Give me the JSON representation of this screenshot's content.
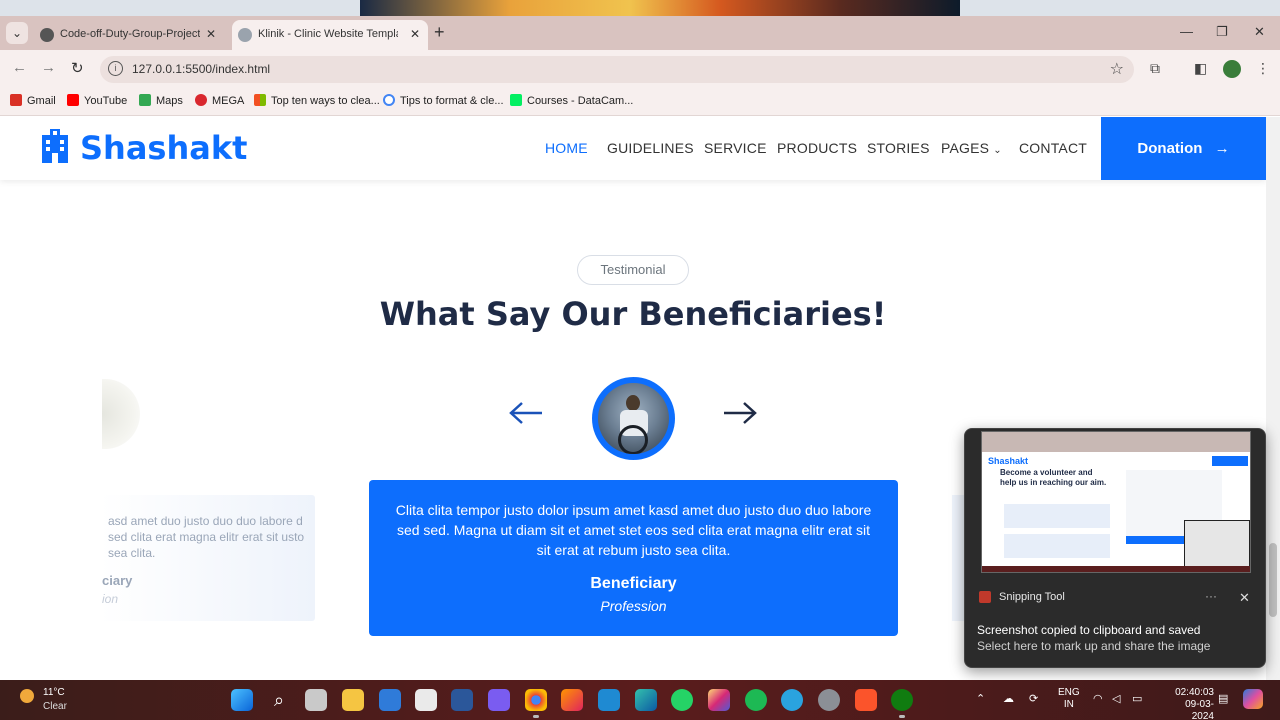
{
  "browser": {
    "tabs": [
      {
        "label": "Code-off-Duty-Group-Project/F",
        "active": false
      },
      {
        "label": "Klinik - Clinic Website Template",
        "active": true
      }
    ],
    "url": "127.0.0.1:5500/index.html",
    "bookmarks": [
      {
        "label": "Gmail",
        "icon": "gmail-icon",
        "color": "#d93025"
      },
      {
        "label": "YouTube",
        "icon": "youtube-icon",
        "color": "#ff0000"
      },
      {
        "label": "Maps",
        "icon": "maps-icon",
        "color": "#34a853"
      },
      {
        "label": "MEGA",
        "icon": "mega-icon",
        "color": "#d9272e"
      },
      {
        "label": "Top ten ways to clea...",
        "icon": "windows-icon",
        "color": "#f25022"
      },
      {
        "label": "Tips to format & cle...",
        "icon": "google-icon",
        "color": "#4285f4"
      },
      {
        "label": "Courses - DataCam...",
        "icon": "datacamp-icon",
        "color": "#03ef62"
      }
    ]
  },
  "site": {
    "brand": "Shashakt",
    "menu": [
      "HOME",
      "GUIDELINES",
      "SERVICE",
      "PRODUCTS",
      "STORIES",
      "PAGES",
      "CONTACT"
    ],
    "active_menu": "HOME",
    "donate_label": "Donation",
    "accent": "#0d6efd"
  },
  "testimonial": {
    "pill": "Testimonial",
    "heading": "What Say Our Beneficiaries!",
    "active": {
      "text": "Clita clita tempor justo dolor ipsum amet kasd amet duo justo duo duo labore sed sed. Magna ut diam sit et amet stet eos sed clita erat magna elitr erat sit sit erat at rebum justo sea clita.",
      "name": "Beneficiary",
      "profession": "Profession"
    },
    "side_left": {
      "text": "asd amet duo justo duo duo labore d sed clita erat magna elitr erat sit usto sea clita.",
      "name": "ciary",
      "profession": "ion"
    }
  },
  "toast": {
    "app": "Snipping Tool",
    "line1": "Screenshot copied to clipboard and saved",
    "line2": "Select here to mark up and share the image",
    "thumb_brand": "Shashakt",
    "thumb_title": "Become a volunteer and help us in reaching our aim."
  },
  "taskbar": {
    "temp": "11°C",
    "weather": "Clear",
    "lang_1": "ENG",
    "lang_2": "IN",
    "time": "02:40:03",
    "date": "09-03-2024"
  }
}
